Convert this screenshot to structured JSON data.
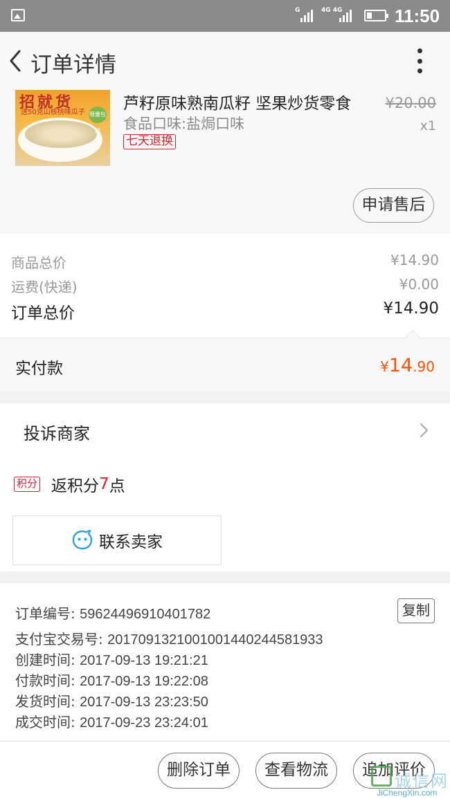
{
  "status_bar": {
    "time": "11:50",
    "net1": "G",
    "net2": "4G 4G"
  },
  "header": {
    "title": "订单详情"
  },
  "product": {
    "image_banner": "招就货",
    "image_caption": "送50克山核桃味瓜子",
    "image_tag": "限量包邮",
    "name": "芦籽原味熟南瓜籽 坚果炒货零食",
    "flavor": "食品口味:盐焗口味",
    "return_badge": "七天退换",
    "original_price": "¥20.00",
    "quantity": "x1",
    "after_sale_button": "申请售后"
  },
  "price": {
    "subtotal_label": "商品总价",
    "subtotal_value": "¥14.90",
    "shipping_label": "运费(快递)",
    "shipping_value": "¥0.00",
    "total_label": "订单总价",
    "total_value": "¥14.90",
    "paid_label": "实付款",
    "paid_currency": "¥",
    "paid_integer": "14",
    "paid_decimal": ".90"
  },
  "actions": {
    "complaint_label": "投诉商家",
    "points_tag": "积分",
    "points_prefix": "返积分",
    "points_value": "7",
    "points_suffix": "点",
    "contact_seller": "联系卖家"
  },
  "order_info": {
    "order_no_label": "订单编号: ",
    "order_no": "59624496910401782",
    "copy_button": "复制",
    "alipay_label": "支付宝交易号: ",
    "alipay_no": "2017091321001001440244581933",
    "created_label": "创建时间: ",
    "created": "2017-09-13 19:21:21",
    "paid_label": "付款时间: ",
    "paid": "2017-09-13 19:22:08",
    "shipped_label": "发货时间: ",
    "shipped": "2017-09-13 23:23:50",
    "completed_label": "成交时间: ",
    "completed": "2017-09-23 23:24:01"
  },
  "bottom_bar": {
    "delete_order": "删除订单",
    "view_logistics": "查看物流",
    "add_review": "追加评价"
  },
  "watermark": {
    "cn": "诚信网",
    "url": "JiChengXin.com"
  },
  "colors": {
    "accent_orange": "#ff5000",
    "badge_red": "#d8202f",
    "status_bar": "#8a8a8a"
  }
}
